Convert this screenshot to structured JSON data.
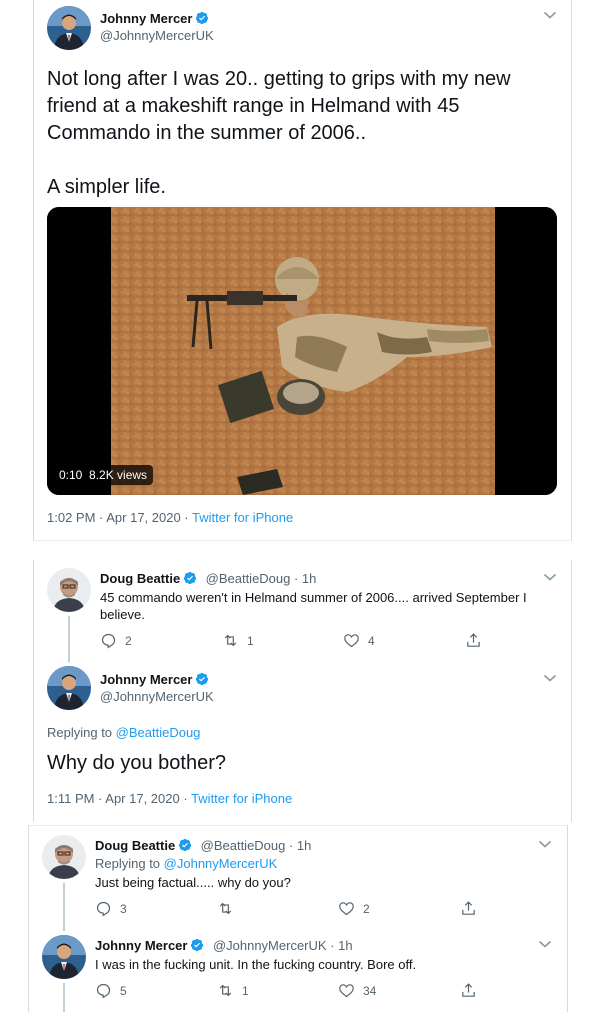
{
  "tweet1": {
    "author": "Johnny Mercer",
    "handle": "@JohnnyMercerUK",
    "text_line1": "Not long after I was 20.. getting to grips with my new",
    "text_line2": "friend at a makeshift range in Helmand with 45",
    "text_line3": "Commando in the summer of 2006..",
    "text_line4": "A simpler life.",
    "video_time": "0:10",
    "video_views": "8.2K views",
    "timestamp": "1:02 PM · Apr 17, 2020 · ",
    "source": "Twitter for iPhone"
  },
  "reply1": {
    "author": "Doug Beattie",
    "handle": "@BeattieDoug · 1h",
    "text_line1": "45 commando weren't in Helmand summer of 2006.... arrived September I",
    "text_line2": "believe.",
    "replies": "2",
    "retweets": "1",
    "likes": "4"
  },
  "tweet2": {
    "author": "Johnny Mercer",
    "handle": "@JohnnyMercerUK",
    "replying_prefix": "Replying to ",
    "replying_to": "@BeattieDoug",
    "text": "Why do you bother?",
    "timestamp": "1:11 PM · Apr 17, 2020 · ",
    "source": "Twitter for iPhone"
  },
  "reply2": {
    "author": "Doug Beattie",
    "handle": "@BeattieDoug · 1h",
    "replying_prefix": "Replying to ",
    "replying_to": "@JohnnyMercerUK",
    "text": "Just being factual..... why do you?",
    "replies": "3",
    "retweets": "",
    "likes": "2"
  },
  "reply3": {
    "author": "Johnny Mercer",
    "handle": "@JohnnyMercerUK · 1h",
    "text": "I was in the fucking unit. In the fucking country. Bore off.",
    "replies": "5",
    "retweets": "1",
    "likes": "34"
  },
  "colors": {
    "accent": "#1d9bf0",
    "muted": "#536471",
    "text": "#0f1419"
  }
}
